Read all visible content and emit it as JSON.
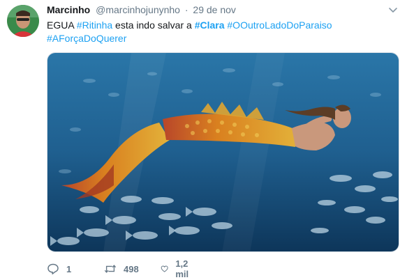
{
  "tweet": {
    "display_name": "Marcinho",
    "handle": "@marcinhojunynho",
    "separator": "·",
    "date": "29 de nov",
    "text_prefix": "EGUA ",
    "tag_ritinha": "#Ritinha",
    "text_middle": " esta indo salvar a ",
    "tag_clara": "#Clara",
    "text_space": " ",
    "tag_outro_lado": "#OOutroLadoDoParaiso",
    "tag_forca": "#AForçaDoQuerer",
    "reply_count": "1",
    "retweet_count": "498",
    "like_count": "1,2 mil"
  },
  "colors": {
    "link": "#1da1f2",
    "secondary_text": "#657786",
    "water": "#1f5f8f"
  },
  "icons": [
    "avatar-photo",
    "chevron-down-icon",
    "reply-icon",
    "retweet-icon",
    "like-icon"
  ]
}
